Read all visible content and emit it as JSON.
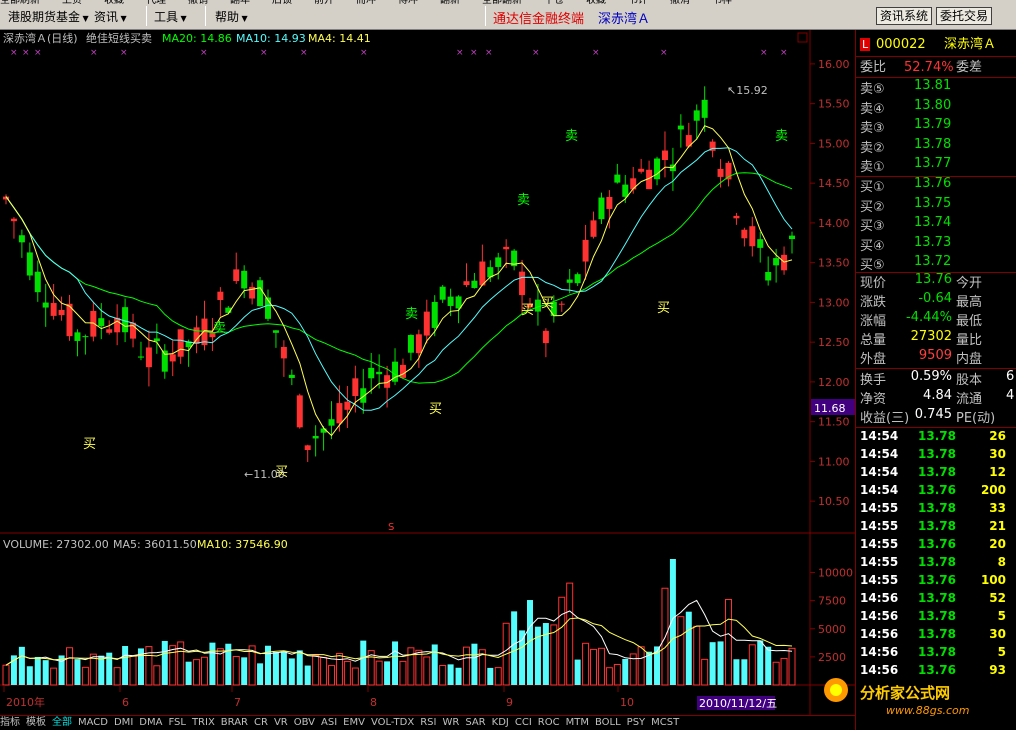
{
  "menubar": {
    "items": [
      "港股期货基金",
      "资讯",
      "工具",
      "帮助"
    ],
    "top_strip": [
      "全部刷新",
      "上负",
      "收藏",
      "代理",
      "撤销",
      "翻年",
      "后锁",
      "前开",
      "而冲",
      "傅冲",
      "翻新",
      "全部翻新",
      "平仓",
      "收藏",
      "书评",
      "撤消",
      "书样"
    ],
    "app_title": "通达信金融终端",
    "stock_title": "深赤湾Ａ",
    "btn_news": "资讯系统",
    "btn_trade": "委托交易"
  },
  "chart": {
    "header_name": "深赤湾Ａ(日线)",
    "header_formula": "绝佳短线买卖",
    "ma20_label": "MA20: 14.86",
    "ma10_label": "MA10: 14.93",
    "ma4_label": "MA4: 14.41",
    "high_marker": "15.92",
    "low_marker": "11.00",
    "current_price_tag": "11.68",
    "s_marker": "S",
    "volume_header": "VOLUME: 27302.00",
    "vol_ma5": "MA5: 36011.50",
    "vol_ma10": "MA10: 37546.90",
    "date_tag": "2010/11/12/五",
    "x_labels": [
      "2010年",
      "6",
      "7",
      "8",
      "9",
      "10"
    ],
    "signals_buy": "买",
    "signals_sell": "卖"
  },
  "chart_data": {
    "type": "candlestick",
    "price_ylim": [
      10.2,
      16.2
    ],
    "price_ticks": [
      "16.00",
      "15.50",
      "15.00",
      "14.50",
      "14.00",
      "13.50",
      "13.00",
      "12.50",
      "12.00",
      "11.50",
      "11.00",
      "10.50"
    ],
    "volume_ticks": [
      "10000",
      "7500",
      "5000",
      "2500"
    ],
    "volume_ylim": [
      0,
      12000
    ]
  },
  "info": {
    "code": "000022",
    "name": "深赤湾Ａ",
    "wei_bi_label": "委比",
    "wei_bi_value": "52.74%",
    "wei_cha_label": "委差",
    "sell": [
      {
        "label": "卖⑤",
        "price": "13.81"
      },
      {
        "label": "卖④",
        "price": "13.80"
      },
      {
        "label": "卖③",
        "price": "13.79"
      },
      {
        "label": "卖②",
        "price": "13.78"
      },
      {
        "label": "卖①",
        "price": "13.77"
      }
    ],
    "buy": [
      {
        "label": "买①",
        "price": "13.76"
      },
      {
        "label": "买②",
        "price": "13.75"
      },
      {
        "label": "买③",
        "price": "13.74"
      },
      {
        "label": "买④",
        "price": "13.73"
      },
      {
        "label": "买⑤",
        "price": "13.72"
      }
    ],
    "stats": [
      {
        "l1": "现价",
        "v": "13.76",
        "l2": "今开",
        "color": "#00e000"
      },
      {
        "l1": "涨跌",
        "v": "-0.64",
        "l2": "最高",
        "color": "#00e000"
      },
      {
        "l1": "涨幅",
        "v": "-4.44%",
        "l2": "最低",
        "color": "#00e000"
      },
      {
        "l1": "总量",
        "v": "27302",
        "l2": "量比",
        "color": "#ffff00"
      },
      {
        "l1": "外盘",
        "v": "9509",
        "l2": "内盘",
        "color": "#ff4040"
      }
    ],
    "stats2": [
      {
        "l1": "换手",
        "v": "0.59%",
        "l2": "股本",
        "tail": "6"
      },
      {
        "l1": "净资",
        "v": "4.84",
        "l2": "流通",
        "tail": "4"
      },
      {
        "l1": "收益(三)",
        "v": "0.745",
        "l2": "PE(动)",
        "tail": ""
      }
    ],
    "ticks": [
      {
        "t": "14:54",
        "p": "13.78",
        "v": "26",
        "pc": "#00e000"
      },
      {
        "t": "14:54",
        "p": "13.78",
        "v": "30",
        "pc": "#00e000"
      },
      {
        "t": "14:54",
        "p": "13.78",
        "v": "12",
        "pc": "#00e000"
      },
      {
        "t": "14:54",
        "p": "13.76",
        "v": "200",
        "pc": "#00e000"
      },
      {
        "t": "14:55",
        "p": "13.78",
        "v": "33",
        "pc": "#00e000"
      },
      {
        "t": "14:55",
        "p": "13.78",
        "v": "21",
        "pc": "#00e000"
      },
      {
        "t": "14:55",
        "p": "13.76",
        "v": "20",
        "pc": "#00e000"
      },
      {
        "t": "14:55",
        "p": "13.78",
        "v": "8",
        "pc": "#00e000"
      },
      {
        "t": "14:55",
        "p": "13.76",
        "v": "100",
        "pc": "#00e000"
      },
      {
        "t": "14:56",
        "p": "13.78",
        "v": "52",
        "pc": "#00e000"
      },
      {
        "t": "14:56",
        "p": "13.78",
        "v": "5",
        "pc": "#00e000"
      },
      {
        "t": "14:56",
        "p": "13.78",
        "v": "30",
        "pc": "#00e000"
      },
      {
        "t": "14:56",
        "p": "13.78",
        "v": "5",
        "pc": "#00e000"
      },
      {
        "t": "14:56",
        "p": "13.76",
        "v": "93",
        "pc": "#00e000"
      }
    ]
  },
  "bottombar": {
    "items": [
      "指标",
      "模板",
      "全部",
      "MACD",
      "DMI",
      "DMA",
      "FSL",
      "TRIX",
      "BRAR",
      "CR",
      "VR",
      "OBV",
      "ASI",
      "EMV",
      "VOL-TDX",
      "RSI",
      "WR",
      "SAR",
      "KDJ",
      "CCI",
      "ROC",
      "MTM",
      "BOLL",
      "PSY",
      "MCST"
    ]
  },
  "watermark": {
    "cn": "分析家公式网",
    "url": "www.88gs.com"
  },
  "colors": {
    "up": "#ff3232",
    "down": "#54fcfc",
    "ma20": "#00ff00",
    "ma10": "#54fcfc",
    "ma4": "#ffff54"
  }
}
